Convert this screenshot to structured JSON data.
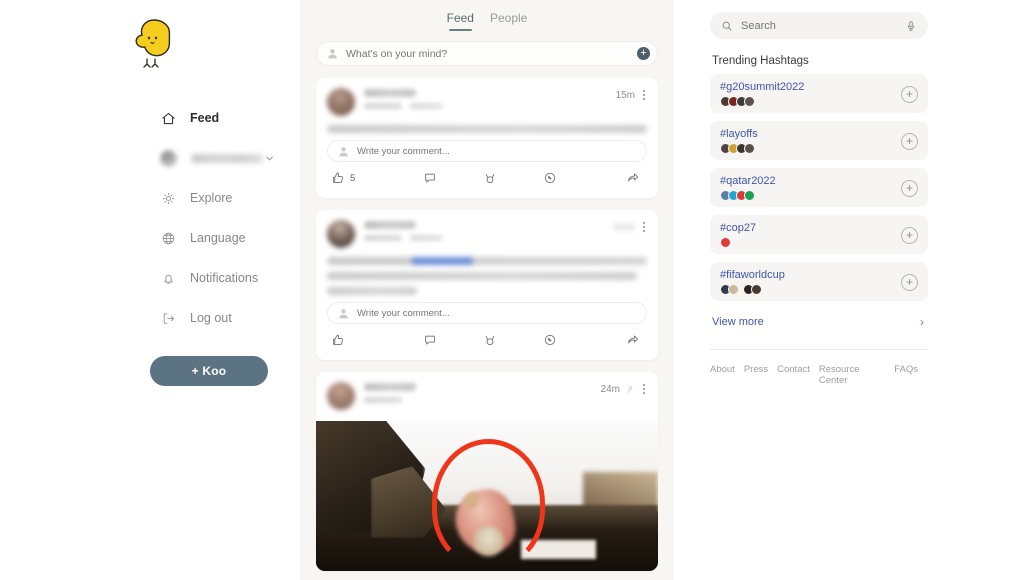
{
  "brand": {
    "logo_alt": "koo-bird-logo",
    "accent": "#5b7382",
    "link_blue": "#3f56a8"
  },
  "sidebar": {
    "items": [
      {
        "label": "Feed",
        "icon": "home-icon",
        "active": true
      },
      {
        "label": "",
        "icon": "avatar-icon",
        "blurred": true,
        "chevron": "chevron-down-icon"
      },
      {
        "label": "Explore",
        "icon": "explore-icon"
      },
      {
        "label": "Language",
        "icon": "globe-icon"
      },
      {
        "label": "Notifications",
        "icon": "bell-icon"
      },
      {
        "label": "Log out",
        "icon": "logout-icon"
      }
    ],
    "koo_button": "+ Koo"
  },
  "feed": {
    "tabs": [
      {
        "label": "Feed",
        "active": true
      },
      {
        "label": "People",
        "active": false
      }
    ],
    "composer": {
      "placeholder": "What's on your mind?",
      "value": "",
      "plus_label": "+"
    },
    "comment_placeholder": "Write your comment...",
    "posts": [
      {
        "time": "15m",
        "likes": "5",
        "has_media": false,
        "actions": [
          "like-icon",
          "comment-icon",
          "rekoo-icon",
          "whatsapp-icon",
          "share-icon"
        ]
      },
      {
        "time": "",
        "likes": "",
        "has_media": false,
        "actions": [
          "like-icon",
          "comment-icon",
          "rekoo-icon",
          "whatsapp-icon",
          "share-icon"
        ]
      },
      {
        "time": "24m",
        "likes": "",
        "has_media": true,
        "actions": []
      }
    ]
  },
  "rail": {
    "search": {
      "placeholder": "Search",
      "value": "",
      "icon": "search-icon",
      "mic": "microphone-icon"
    },
    "trending_title": "Trending Hashtags",
    "hashtags": [
      {
        "tag": "#g20summit2022",
        "add": "+",
        "avatars": [
          "#4a3a33",
          "#7d2420",
          "#3e3a38",
          "#5c5350"
        ]
      },
      {
        "tag": "#layoffs",
        "add": "+",
        "avatars": [
          "#4d4440",
          "#d0a033",
          "#3b3330",
          "#5a504a"
        ]
      },
      {
        "tag": "#qatar2022",
        "add": "+",
        "avatars": [
          "#5b7fa8",
          "#1fa6d8",
          "#d93b3b",
          "#1f9e57"
        ]
      },
      {
        "tag": "#cop27",
        "add": "+",
        "avatars": [
          "#e03b3b"
        ]
      },
      {
        "tag": "#fifaworldcup",
        "add": "+",
        "avatars": [
          "#2f3a4d",
          "#cbb89b",
          "#2a2320",
          "#4a3b33"
        ]
      }
    ],
    "view_more": "View more",
    "footer": [
      "About",
      "Press",
      "Contact",
      "Resource Center",
      "FAQs"
    ]
  }
}
